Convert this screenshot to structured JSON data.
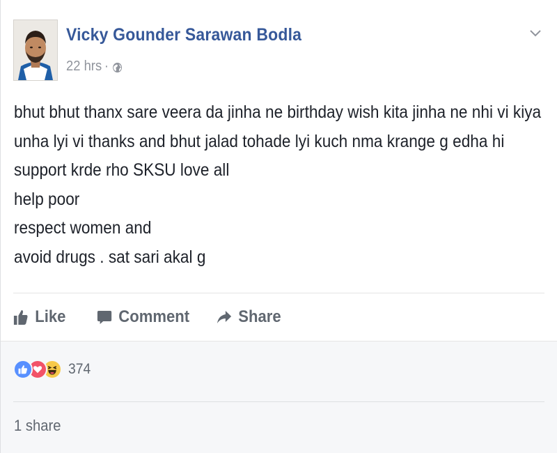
{
  "post": {
    "author": "Vicky Gounder Sarawan Bodla",
    "timestamp": "22 hrs",
    "separator": "·",
    "privacy_icon": "globe-icon",
    "menu_icon": "chevron-down-icon",
    "body_lines": [
      "bhut bhut thanx sare veera da jinha ne birthday wish kita jinha ne nhi vi kiya",
      "unha lyi vi thanks and bhut jalad tohade lyi kuch nma krange g edha hi",
      "support krde rho SKSU love all",
      "help poor",
      "respect women and",
      "avoid drugs . sat sari akal g"
    ]
  },
  "actions": {
    "like": "Like",
    "comment": "Comment",
    "share": "Share"
  },
  "footer": {
    "reaction_icons": [
      "like-reaction-icon",
      "love-reaction-icon",
      "haha-reaction-icon"
    ],
    "reaction_count": "374",
    "shares": "1 share"
  },
  "colors": {
    "author": "#365899",
    "text": "#1d2129",
    "muted": "#90949c",
    "action": "#606770",
    "like": "#5890ff",
    "love": "#f25268",
    "haha": "#f7c94a"
  }
}
